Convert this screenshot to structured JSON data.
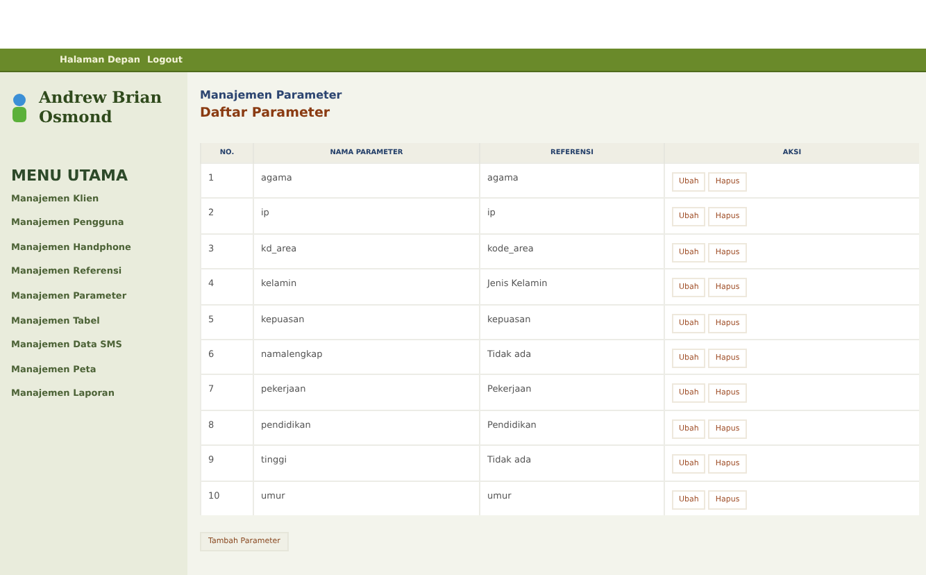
{
  "nav": [
    "Halaman Depan",
    "Logout"
  ],
  "user": {
    "name": "Andrew Brian Osmond"
  },
  "menu": {
    "title": "MENU UTAMA",
    "items": [
      "Manajemen Klien",
      "Manajemen Pengguna",
      "Manajemen Handphone",
      "Manajemen Referensi",
      "Manajemen Parameter",
      "Manajemen Tabel",
      "Manajemen Data SMS",
      "Manajemen Peta",
      "Manajemen Laporan"
    ]
  },
  "breadcrumb": "Manajemen Parameter",
  "page_title": "Daftar Parameter",
  "table": {
    "columns": [
      "NO.",
      "NAMA PARAMETER",
      "REFERENSI",
      "AKSI"
    ],
    "rows": [
      {
        "no": "1",
        "name": "agama",
        "ref": "agama",
        "actions": [
          "Ubah",
          "Hapus"
        ]
      },
      {
        "no": "2",
        "name": "ip",
        "ref": "ip",
        "actions": [
          "Ubah",
          "Hapus"
        ]
      },
      {
        "no": "3",
        "name": "kd_area",
        "ref": "kode_area",
        "actions": [
          "Ubah",
          "Hapus"
        ]
      },
      {
        "no": "4",
        "name": "kelamin",
        "ref": "Jenis Kelamin",
        "actions": [
          "Ubah",
          "Hapus"
        ]
      },
      {
        "no": "5",
        "name": "kepuasan",
        "ref": "kepuasan",
        "actions": [
          "Ubah",
          "Hapus"
        ]
      },
      {
        "no": "6",
        "name": "namalengkap",
        "ref": "Tidak ada",
        "actions": [
          "Ubah",
          "Hapus"
        ]
      },
      {
        "no": "7",
        "name": "pekerjaan",
        "ref": "Pekerjaan",
        "actions": [
          "Ubah",
          "Hapus"
        ]
      },
      {
        "no": "8",
        "name": "pendidikan",
        "ref": "Pendidikan",
        "actions": [
          "Ubah",
          "Hapus"
        ]
      },
      {
        "no": "9",
        "name": "tinggi",
        "ref": "Tidak ada",
        "actions": [
          "Ubah",
          "Hapus"
        ]
      },
      {
        "no": "10",
        "name": "umur",
        "ref": "umur",
        "actions": [
          "Ubah",
          "Hapus"
        ]
      }
    ]
  },
  "add_button": "Tambah Parameter"
}
